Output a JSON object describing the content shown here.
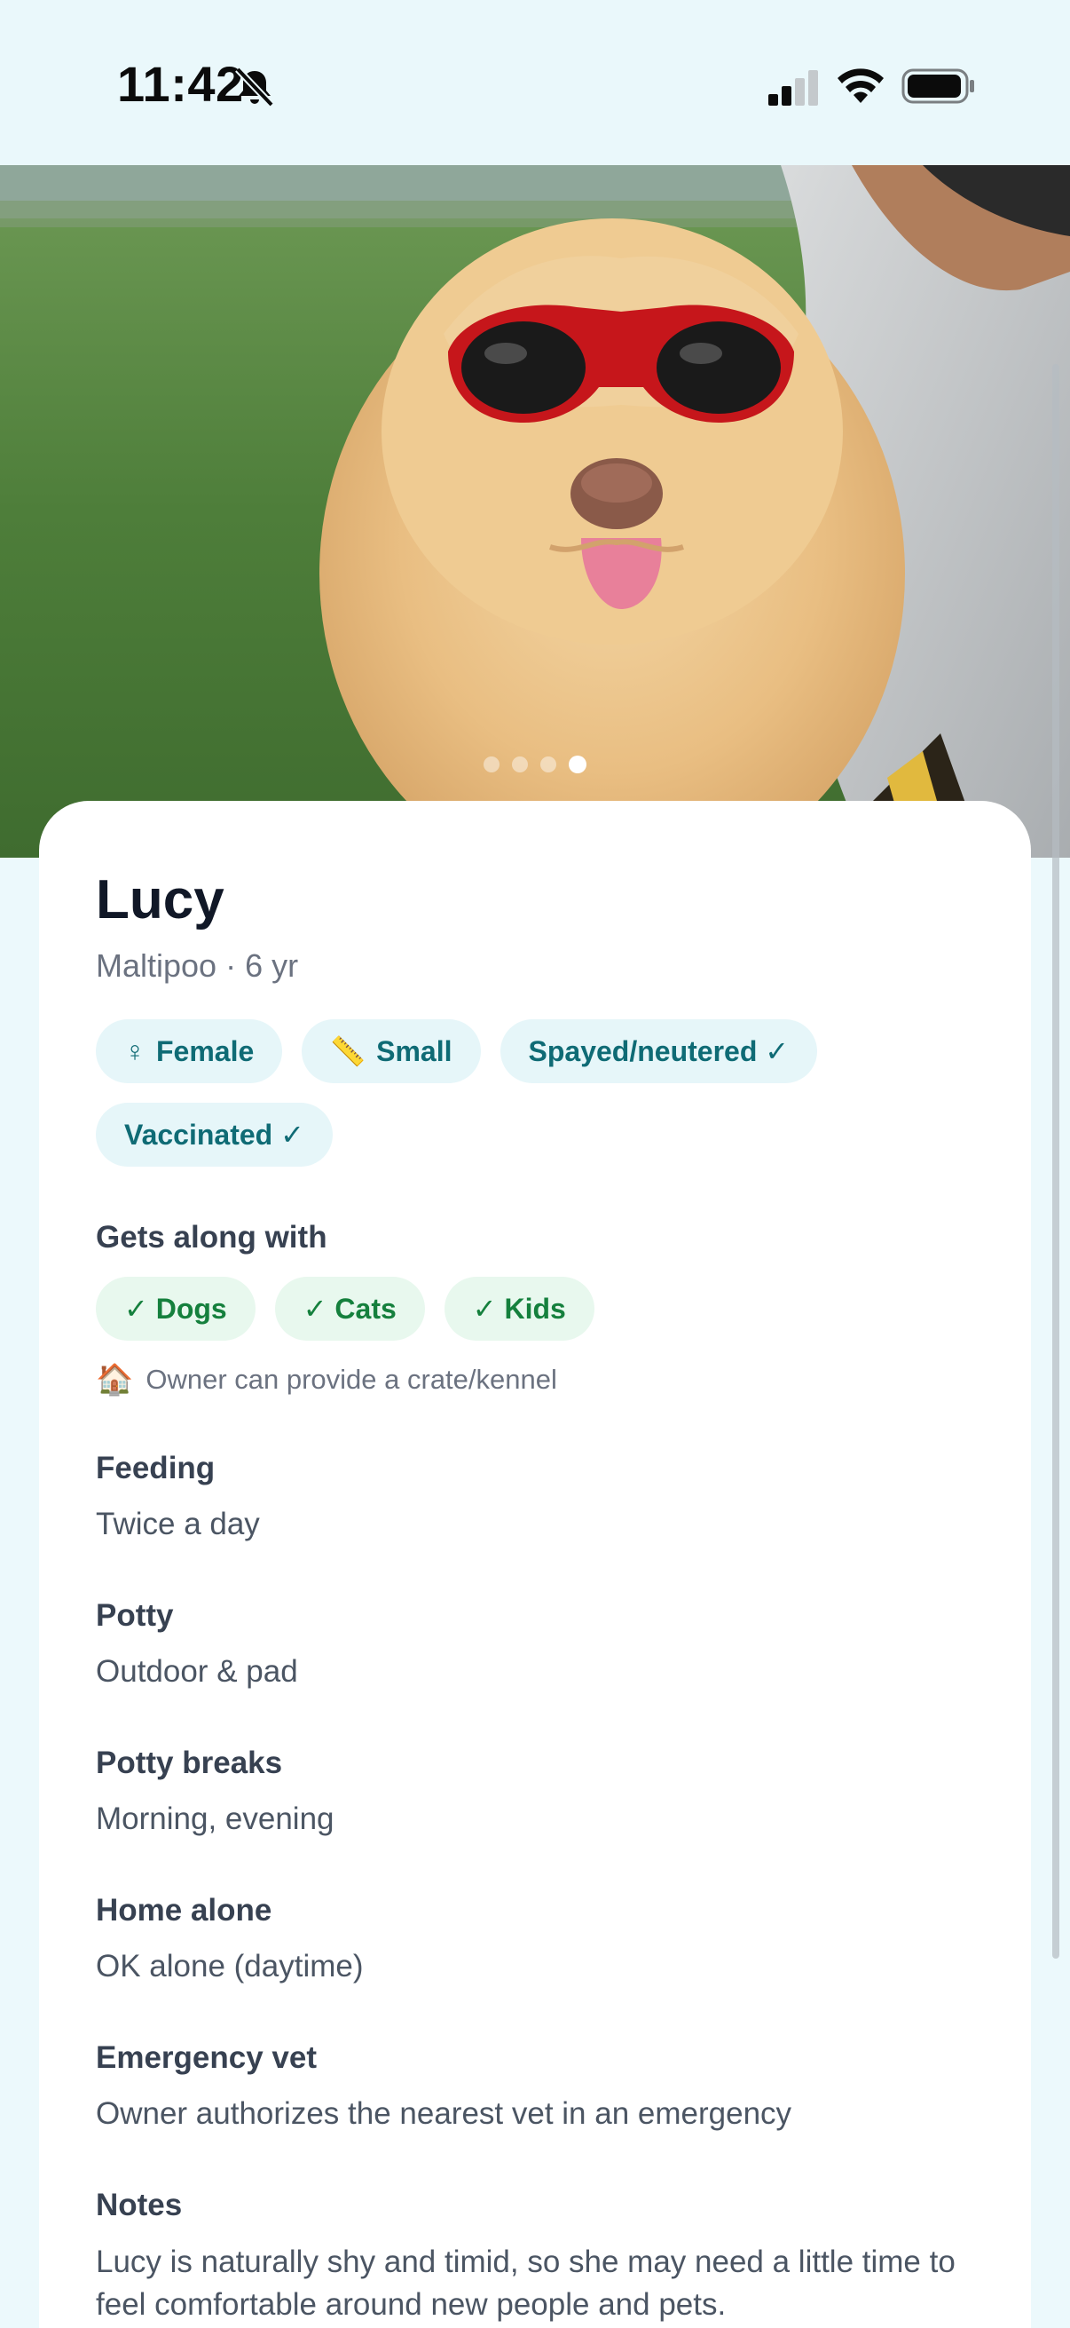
{
  "status_bar": {
    "time": "11:42",
    "icons": [
      "bell-slash-icon",
      "cellular-signal-icon",
      "wifi-icon",
      "battery-icon"
    ]
  },
  "carousel": {
    "photo_alt": "Photo of Lucy, a fluffy apricot dog wearing red goggles",
    "total_photos": 4,
    "active_index": 3
  },
  "pet": {
    "name": "Lucy",
    "subtitle": "Maltipoo · 6 yr"
  },
  "attributes": [
    {
      "icon": "♀",
      "label": "Female"
    },
    {
      "icon": "📏",
      "label": "Small"
    },
    {
      "icon": "",
      "label": "Spayed/neutered ✓"
    },
    {
      "icon": "",
      "label": "Vaccinated ✓"
    }
  ],
  "gets_along": {
    "heading": "Gets along with",
    "items": [
      "✓ Dogs",
      "✓ Cats",
      "✓ Kids"
    ]
  },
  "crate_note": {
    "icon": "🏠",
    "text": "Owner can provide a crate/kennel"
  },
  "details": [
    {
      "label": "Feeding",
      "value": "Twice a day"
    },
    {
      "label": "Potty",
      "value": "Outdoor & pad"
    },
    {
      "label": "Potty breaks",
      "value": "Morning, evening"
    },
    {
      "label": "Home alone",
      "value": "OK alone (daytime)"
    },
    {
      "label": "Emergency vet",
      "value": "Owner authorizes the nearest vet in an emergency"
    }
  ],
  "notes": {
    "label": "Notes",
    "value": "Lucy is naturally shy and timid, so she may need a little time to feel comfortable around new people and pets."
  },
  "colors": {
    "page_bg": "#ECF9FC",
    "chip_bg": "#E6F6F9",
    "chip_text": "#0F6B75",
    "green_chip_bg": "#E8F8EE",
    "green_chip_text": "#15803D"
  }
}
